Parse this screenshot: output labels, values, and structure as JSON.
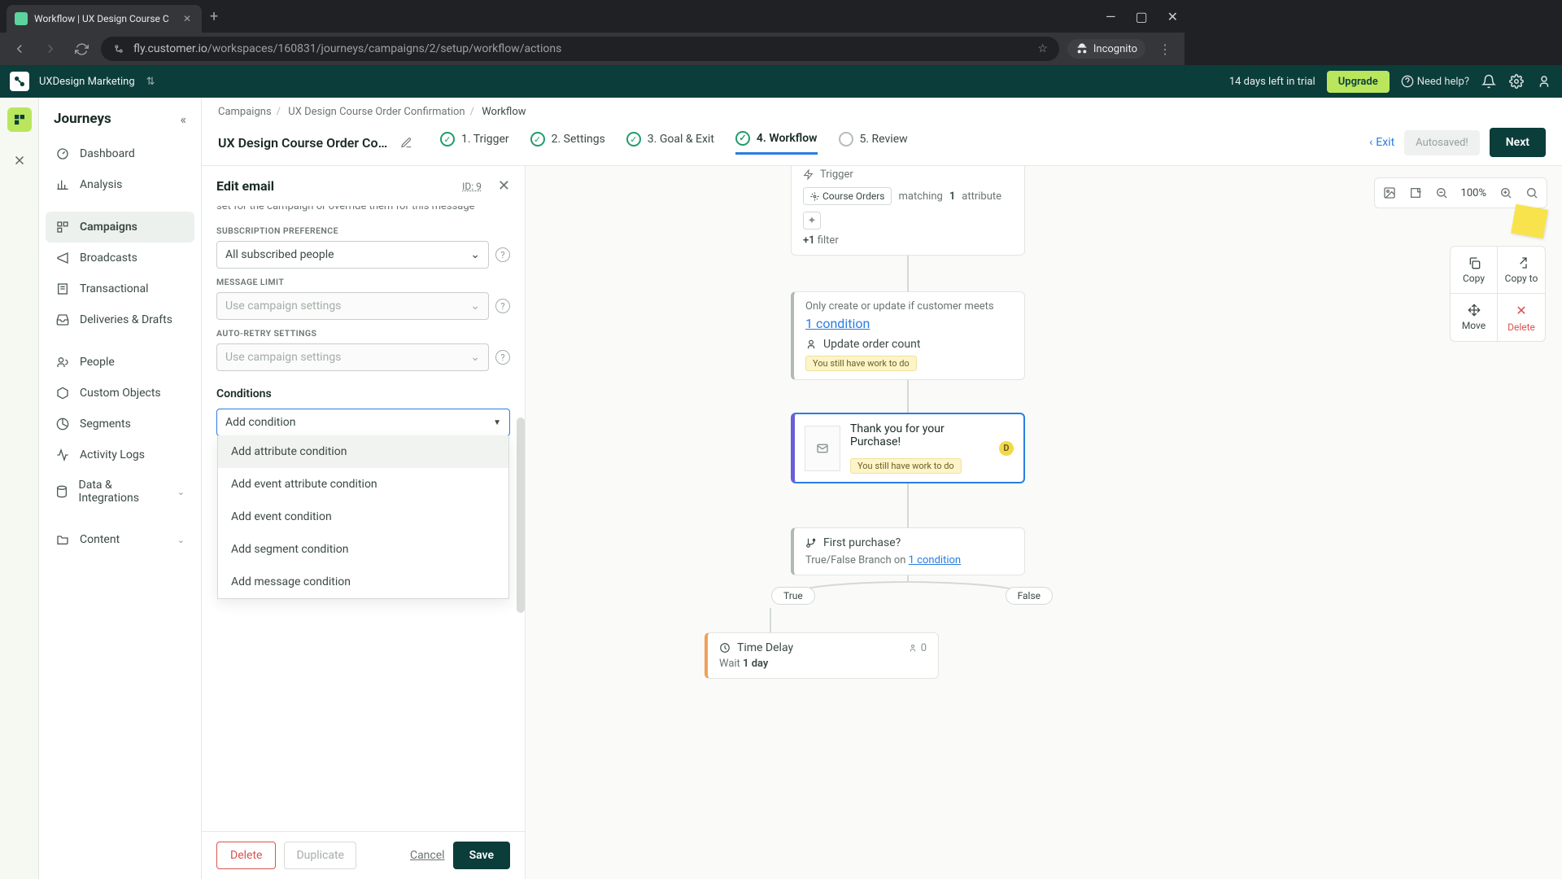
{
  "browser": {
    "tab_title": "Workflow | UX Design Course C",
    "url_host": "fly.customer.io",
    "url_path": "/workspaces/160831/journeys/campaigns/2/setup/workflow/actions",
    "incognito": "Incognito"
  },
  "header": {
    "workspace": "UXDesign Marketing",
    "trial": "14 days left in trial",
    "upgrade": "Upgrade",
    "need_help": "Need help?"
  },
  "sidebar": {
    "title": "Journeys",
    "items": [
      {
        "label": "Dashboard"
      },
      {
        "label": "Analysis"
      },
      {
        "label": "Campaigns"
      },
      {
        "label": "Broadcasts"
      },
      {
        "label": "Transactional"
      },
      {
        "label": "Deliveries & Drafts"
      },
      {
        "label": "People"
      },
      {
        "label": "Custom Objects"
      },
      {
        "label": "Segments"
      },
      {
        "label": "Activity Logs"
      },
      {
        "label": "Data & Integrations"
      },
      {
        "label": "Content"
      }
    ]
  },
  "breadcrumbs": {
    "a": "Campaigns",
    "b": "UX Design Course Order Confirmation",
    "c": "Workflow"
  },
  "page": {
    "title": "UX Design Course Order Confir…",
    "steps": {
      "s1": "1. Trigger",
      "s2": "2. Settings",
      "s3": "3. Goal & Exit",
      "s4": "4. Workflow",
      "s5": "5. Review"
    },
    "exit": "Exit",
    "autosaved": "Autosaved!",
    "next": "Next"
  },
  "edit_panel": {
    "title": "Edit email",
    "id_label": "ID: 9",
    "help_text": "set for the campaign or override them for this message",
    "sub_pref_label": "SUBSCRIPTION PREFERENCE",
    "sub_pref_value": "All subscribed people",
    "msg_limit_label": "MESSAGE LIMIT",
    "msg_limit_value": "Use campaign settings",
    "retry_label": "AUTO-RETRY SETTINGS",
    "retry_value": "Use campaign settings",
    "conditions_title": "Conditions",
    "add_condition": "Add condition",
    "opts": {
      "o1": "Add attribute condition",
      "o2": "Add event attribute condition",
      "o3": "Add event condition",
      "o4": "Add segment condition",
      "o5": "Add message condition"
    },
    "footer": {
      "delete": "Delete",
      "duplicate": "Duplicate",
      "cancel": "Cancel",
      "save": "Save"
    }
  },
  "canvas": {
    "zoom": "100%",
    "tools": {
      "copy": "Copy",
      "copyto": "Copy to",
      "move": "Move",
      "delete": "Delete"
    },
    "trigger": {
      "label": "Trigger",
      "chip": "Course Orders",
      "match_pre": "matching",
      "match_num": "1",
      "match_post": "attribute",
      "filter": "+1 filter"
    },
    "update": {
      "note": "Only create or update if customer meets",
      "cond": "1 condition",
      "title": "Update order count",
      "badge": "You still have work to do"
    },
    "email": {
      "title": "Thank you for your Purchase!",
      "badge": "You still have work to do"
    },
    "branch": {
      "title": "First purchase?",
      "sub_pre": "True/False Branch on ",
      "sub_link": "1 condition",
      "true": "True",
      "false": "False"
    },
    "delay": {
      "title": "Time Delay",
      "count": "0",
      "sub_pre": "Wait ",
      "sub_bold": "1 day"
    }
  }
}
